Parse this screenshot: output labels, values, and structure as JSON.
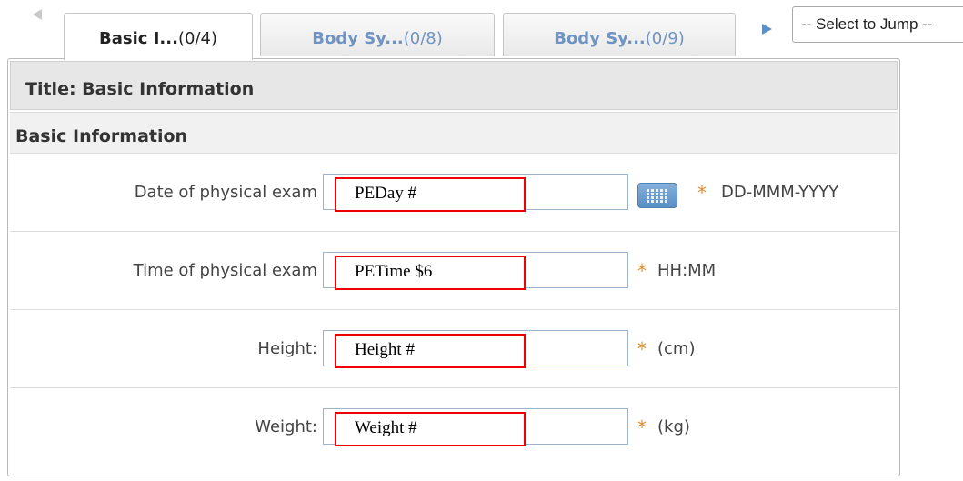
{
  "tabs": [
    {
      "name": "Basic I...",
      "count": "(0/4)",
      "active": true
    },
    {
      "name": "Body Sy...",
      "count": "(0/8)",
      "active": false
    },
    {
      "name": "Body Sy...",
      "count": "(0/9)",
      "active": false
    }
  ],
  "jump_select": {
    "value": "-- Select to Jump --"
  },
  "panel": {
    "title": "Title: Basic Information",
    "section": "Basic Information",
    "fields": [
      {
        "label": "Date of physical exam",
        "annotation": "PEDay #",
        "required": "*",
        "hint": "DD-MMM-YYYY",
        "icon": "calendar-icon"
      },
      {
        "label": "Time of physical exam",
        "annotation": "PETime $6",
        "required": "*",
        "hint": "HH:MM"
      },
      {
        "label": "Height:",
        "annotation": "Height #",
        "required": "*",
        "hint": "(cm)"
      },
      {
        "label": "Weight:",
        "annotation": "Weight #",
        "required": "*",
        "hint": "(kg)"
      }
    ]
  },
  "colors": {
    "tab_inactive_text": "#6f93c2",
    "required_star": "#e38b2c",
    "annotation_border": "#ee0000",
    "input_border": "#9db3cc"
  }
}
